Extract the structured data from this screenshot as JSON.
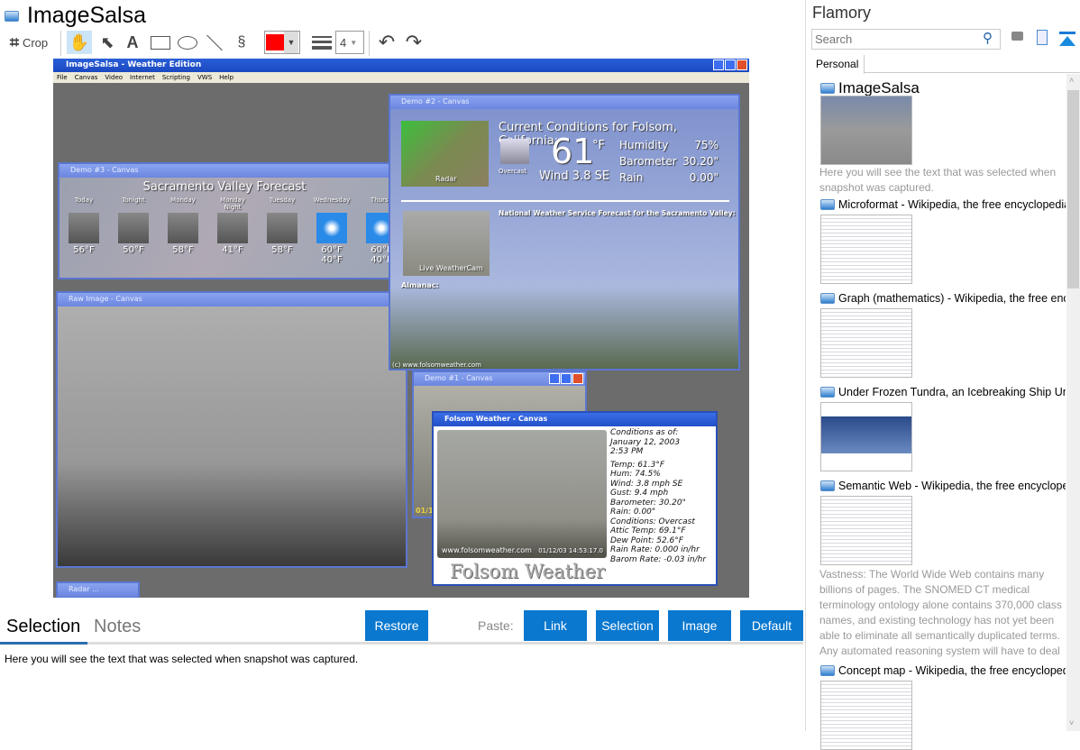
{
  "app": {
    "title": "ImageSalsa"
  },
  "toolbar": {
    "crop_label": "Crop",
    "line_width": "4",
    "color": "#ff0000"
  },
  "screenshot": {
    "app_title": "ImageSalsa - Weather Edition",
    "menu": [
      "File",
      "Canvas",
      "Video",
      "Internet",
      "Scripting",
      "VWS",
      "Help"
    ],
    "demo3": {
      "title": "Demo #3 - Canvas",
      "heading": "Sacramento Valley Forecast",
      "days": [
        {
          "d": "Today",
          "t": "56°F"
        },
        {
          "d": "Tonight",
          "t": "50°F"
        },
        {
          "d": "Monday",
          "t": "58°F"
        },
        {
          "d": "Monday Night",
          "t": "41°F"
        },
        {
          "d": "Tuesday",
          "t": "58°F"
        },
        {
          "d": "Wednesday",
          "t": "60°F 40°F"
        },
        {
          "d": "Thursd",
          "t": "60°F 40°F"
        }
      ]
    },
    "raw": {
      "title": "Raw Image - Canvas"
    },
    "demo2": {
      "title": "Demo #2 - Canvas",
      "heading": "Current Conditions for Folsom, California:",
      "temp": "61",
      "unit": "°F",
      "sky": "Overcast",
      "wind": "Wind 3.8 SE",
      "stats": [
        {
          "k": "Humidity",
          "v": "75%"
        },
        {
          "k": "Barometer",
          "v": "30.20\""
        },
        {
          "k": "Rain",
          "v": "0.00\""
        }
      ],
      "nws": "National Weather Service Forecast for the Sacramento Valley:",
      "cam": "Live WeatherCam",
      "almanac": "Almanac:",
      "radar": "Radar",
      "credit": "(c) www.folsomweather.com"
    },
    "demo1": {
      "title": "Demo #1 - Canvas",
      "stamp": "01/12"
    },
    "folsom": {
      "title": "Folsom Weather - Canvas",
      "site": "www.folsomweather.com",
      "time": "01/12/03 14:53:17.0",
      "brand": "Folsom Weather",
      "lines": [
        "Conditions as of:",
        "January 12, 2003",
        "2:53 PM",
        "Temp: 61.3°F",
        "Hum: 74.5%",
        "Wind: 3.8 mph SE",
        "Gust: 9.4 mph",
        "Barometer: 30.20\"",
        "Rain: 0.00\"",
        "Conditions: Overcast",
        "Attic Temp: 69.1°F",
        "Dew Point: 52.6°F",
        "Rain Rate: 0.000 in/hr",
        "Barom Rate: -0.03 in/hr"
      ]
    },
    "radar": {
      "title": "Radar ..."
    }
  },
  "bottom": {
    "tabs": [
      "Selection",
      "Notes"
    ],
    "restore": "Restore",
    "paste": "Paste:",
    "buttons": [
      "Link",
      "Selection",
      "Image",
      "Default"
    ],
    "text": "Here you will see the text that was selected when snapshot was captured."
  },
  "flamory": {
    "title": "Flamory",
    "search_placeholder": "Search",
    "tab": "Personal",
    "items": [
      {
        "title": "ImageSalsa",
        "desc": "Here you will see the text that was selected when snapshot was captured."
      },
      {
        "title": "Microformat - Wikipedia, the free encyclopedia"
      },
      {
        "title": "Graph (mathematics) - Wikipedia, the free encyclopedia"
      },
      {
        "title": "Under Frozen Tundra, an Icebreaking Ship Uncovers"
      },
      {
        "title": "Semantic Web - Wikipedia, the free encyclopedia",
        "desc": "Vastness: The World Wide Web contains many billions of pages. The SNOMED CT medical terminology ontology alone contains 370,000 class names, and existing technology has not yet been able to eliminate all semantically duplicated terms. Any automated reasoning system will have to deal with truly huge inputs."
      },
      {
        "title": "Concept map - Wikipedia, the free encyclopedia"
      }
    ]
  },
  "colors": {
    "accent": "#0a78cf"
  }
}
